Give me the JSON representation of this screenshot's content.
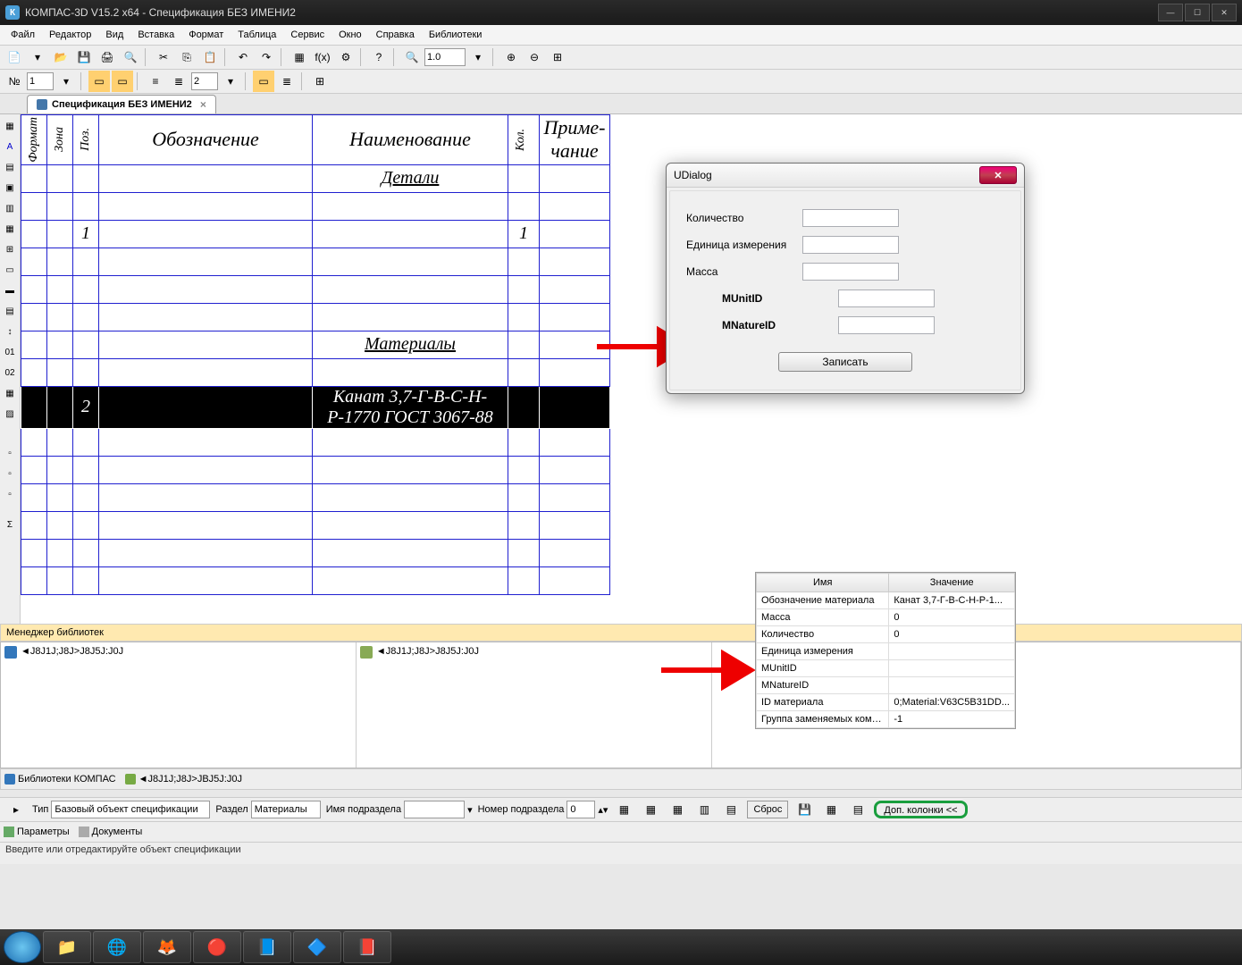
{
  "title": "КОМПАС-3D V15.2  x64 - Спецификация БЕЗ ИМЕНИ2",
  "app_icon": "К",
  "menu": {
    "file": "Файл",
    "edit": "Редактор",
    "view": "Вид",
    "insert": "Вставка",
    "format": "Формат",
    "table": "Таблица",
    "service": "Сервис",
    "window": "Окно",
    "help": "Справка",
    "libs": "Библиотеки"
  },
  "toolbar1": {
    "zoom": "1.0"
  },
  "toolbar2": {
    "num": "1",
    "num2": "2"
  },
  "doc_tab": "Спецификация БЕЗ ИМЕНИ2",
  "spec_headers": {
    "format": "Формат",
    "zone": "Зона",
    "pos": "Поз.",
    "obz": "Обозначение",
    "nam": "Наименование",
    "kol": "Кол.",
    "prim": "Приме-\nчание"
  },
  "spec_rows": [
    {
      "type": "section",
      "nam": "Детали"
    },
    {
      "type": "blank"
    },
    {
      "type": "data",
      "pos": "1",
      "kol": "1"
    },
    {
      "type": "blank"
    },
    {
      "type": "blank"
    },
    {
      "type": "blank"
    },
    {
      "type": "section",
      "nam": "Материалы"
    },
    {
      "type": "blank"
    },
    {
      "type": "selected",
      "pos": "2",
      "nam": "Канат 3,7-Г-В-С-Н-Р-1770 ГОСТ 3067-88"
    },
    {
      "type": "blank"
    },
    {
      "type": "blank"
    },
    {
      "type": "blank"
    },
    {
      "type": "blank"
    },
    {
      "type": "blank"
    },
    {
      "type": "blank"
    }
  ],
  "dialog": {
    "title": "UDialog",
    "fields": {
      "qty": "Количество",
      "unit": "Единица измерения",
      "mass": "Масса",
      "munitid": "MUnitID",
      "mnatureid": "MNatureID"
    },
    "save": "Записать"
  },
  "libmgr_title": "Менеджер библиотек",
  "lib_item": "◄J8J1J;J8J>J8J5J:J0J",
  "lib_tab1": "Библиотеки КОМПАС",
  "lib_tab2": "◄J8J1J;J8J>JBJ5J:J0J",
  "prop": {
    "h1": "Имя",
    "h2": "Значение",
    "rows": [
      {
        "n": "Обозначение материала",
        "v": "Канат 3,7-Г-В-С-Н-Р-1..."
      },
      {
        "n": "Масса",
        "v": "0"
      },
      {
        "n": "Количество",
        "v": "0"
      },
      {
        "n": "Единица измерения",
        "v": ""
      },
      {
        "n": "MUnitID",
        "v": ""
      },
      {
        "n": "MNatureID",
        "v": ""
      },
      {
        "n": "ID материала",
        "v": "0;Material:V63C5B31DD..."
      },
      {
        "n": "Группа заменяемых компон...",
        "v": "-1"
      }
    ]
  },
  "bottombar": {
    "type_lbl": "Тип",
    "type_val": "Базовый объект спецификации",
    "section_lbl": "Раздел",
    "section_val": "Материалы",
    "subname_lbl": "Имя подраздела",
    "subname_val": "",
    "subnum_lbl": "Номер подраздела",
    "subnum_val": "0",
    "reset": "Сброс",
    "dop": "Доп. колонки  <<"
  },
  "tabstrip": {
    "params": "Параметры",
    "docs": "Документы"
  },
  "statusbar": "Введите или отредактируйте объект спецификации"
}
